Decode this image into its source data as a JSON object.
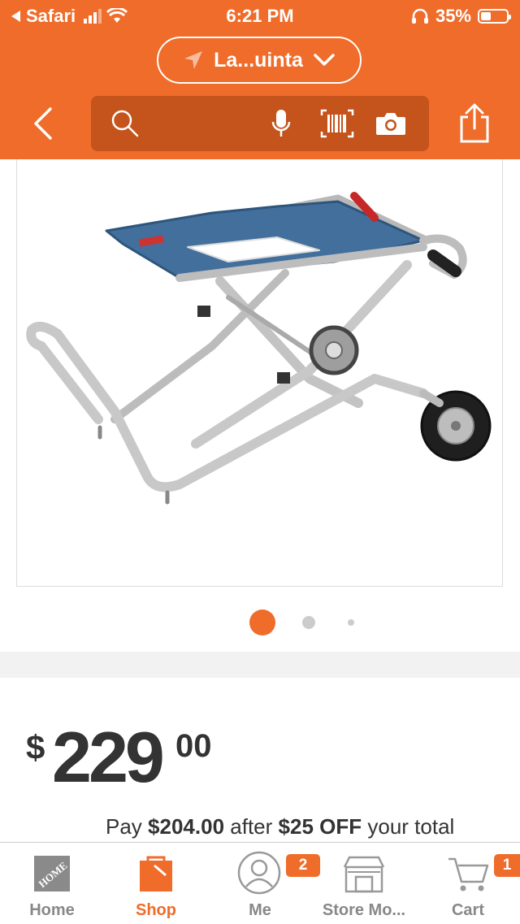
{
  "status_bar": {
    "back_app": "Safari",
    "time": "6:21 PM",
    "battery_percent": "35%",
    "battery_level": 0.35
  },
  "location": {
    "label": "La...uinta"
  },
  "search": {
    "placeholder": ""
  },
  "gallery": {
    "image_count": 3,
    "active_index": 0
  },
  "price": {
    "currency": "$",
    "whole": "229",
    "cents": "00"
  },
  "promo": {
    "prefix": "Pay",
    "amount": "$204.00",
    "middle": "after",
    "discount": "$25 OFF",
    "suffix": "your total"
  },
  "tabs": [
    {
      "label": "Home",
      "icon": "home-depot-logo-icon"
    },
    {
      "label": "Shop",
      "icon": "shop-bag-icon",
      "active": true
    },
    {
      "label": "Me",
      "icon": "user-icon",
      "badge": "2"
    },
    {
      "label": "Store Mo...",
      "icon": "store-icon"
    },
    {
      "label": "Cart",
      "icon": "cart-icon",
      "badge": "1"
    }
  ],
  "colors": {
    "brand": "#ef6c2a",
    "search_bg": "#c4531c"
  }
}
